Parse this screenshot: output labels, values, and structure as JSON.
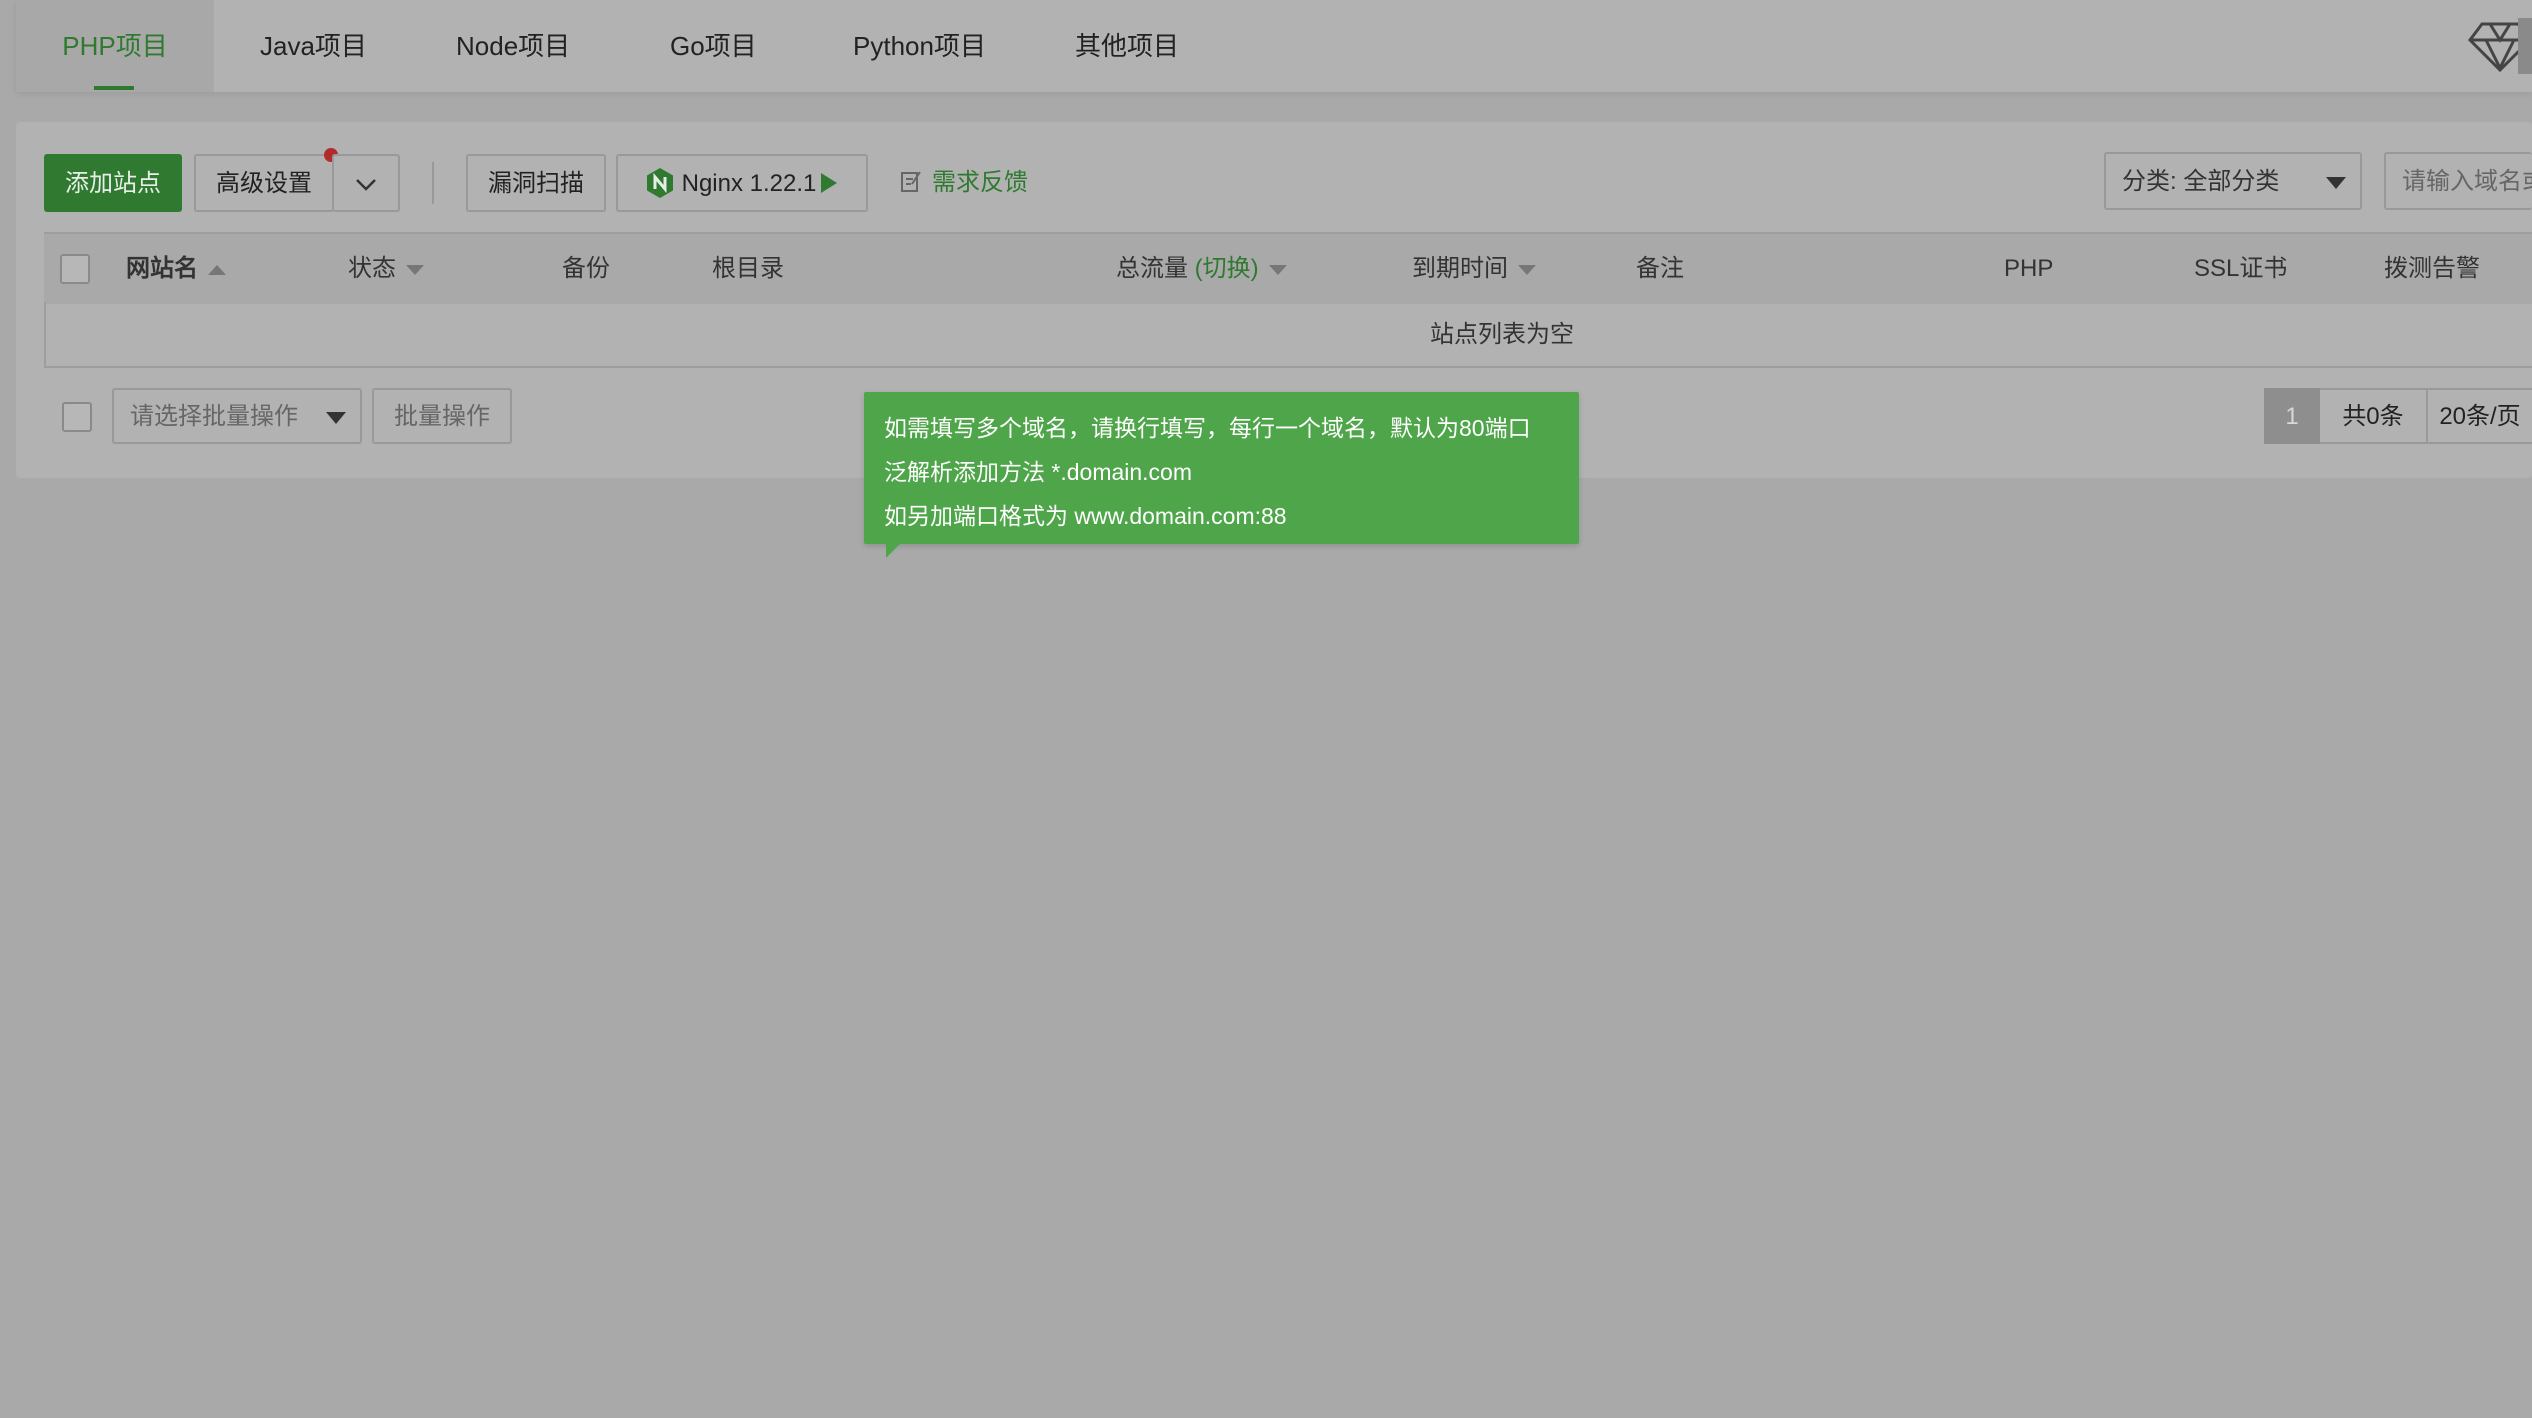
{
  "tabs": [
    {
      "label": "PHP项目",
      "active": true
    },
    {
      "label": "Java项目",
      "active": false
    },
    {
      "label": "Node项目",
      "active": false
    },
    {
      "label": "Go项目",
      "active": false
    },
    {
      "label": "Python项目",
      "active": false
    },
    {
      "label": "其他项目",
      "active": false
    }
  ],
  "toolbar": {
    "add_site": "添加站点",
    "advanced": "高级设置",
    "scan": "漏洞扫描",
    "nginx": "Nginx 1.22.1",
    "feedback": "需求反馈",
    "category_select": "分类: 全部分类",
    "search_placeholder": "请输入域名或"
  },
  "table": {
    "columns": [
      "网站名",
      "状态",
      "备份",
      "根目录",
      "总流量",
      "(切换)",
      "到期时间",
      "备注",
      "PHP",
      "SSL证书",
      "拨测告警"
    ],
    "empty_text": "站点列表为空"
  },
  "footer": {
    "batch_select": "请选择批量操作",
    "batch_button": "批量操作",
    "page_current": "1",
    "total": "共0条",
    "per_page": "20条/页"
  },
  "tooltip": {
    "lines": [
      "如需填写多个域名，请换行填写，每行一个域名，默认为80端口",
      "泛解析添加方法 *.domain.com",
      "如另加端口格式为 www.domain.com:88"
    ]
  },
  "colors": {
    "brand_green": "#2f7a30",
    "tooltip_green": "#4fa54a",
    "notice_dot": "#b12b2b",
    "overlay_bg": "#a9a9a9"
  },
  "icons": [
    "vip-diamond-icon",
    "chevron-down-icon",
    "nginx-icon",
    "play-icon",
    "edit-icon",
    "caret-down-icon",
    "sort-asc-icon",
    "sort-desc-icon"
  ]
}
